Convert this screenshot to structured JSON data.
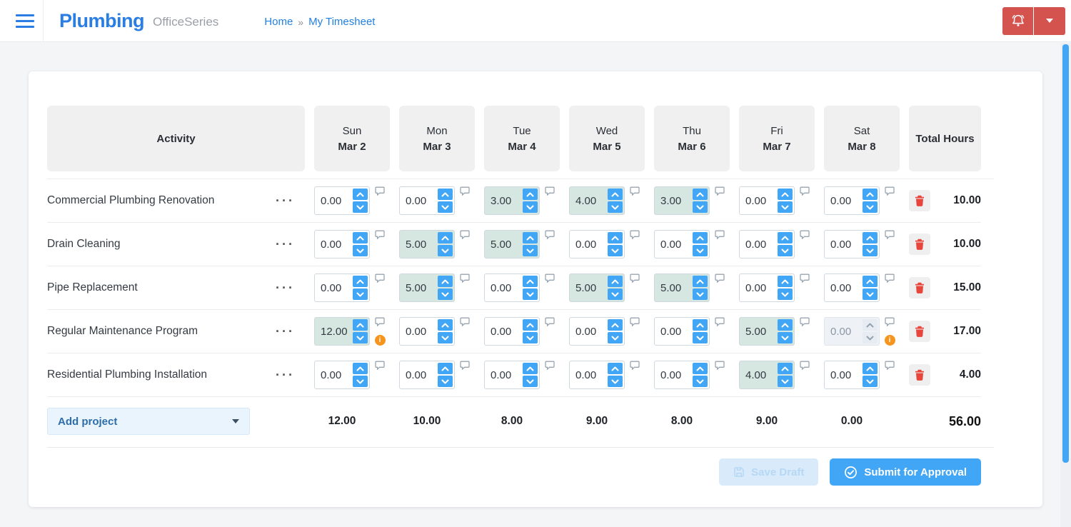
{
  "topbar": {
    "brand": "Plumbing",
    "suite": "OfficeSeries",
    "breadcrumb": {
      "home": "Home",
      "sep": "»",
      "current": "My Timesheet"
    }
  },
  "timesheet": {
    "columns": {
      "activity": "Activity",
      "days": [
        {
          "day": "Sun",
          "date": "Mar 2"
        },
        {
          "day": "Mon",
          "date": "Mar 3"
        },
        {
          "day": "Tue",
          "date": "Mar 4"
        },
        {
          "day": "Wed",
          "date": "Mar 5"
        },
        {
          "day": "Thu",
          "date": "Mar 6"
        },
        {
          "day": "Fri",
          "date": "Mar 7"
        },
        {
          "day": "Sat",
          "date": "Mar 8"
        }
      ],
      "total": "Total Hours"
    },
    "rows": [
      {
        "activity": "Commercial Plumbing Renovation",
        "cells": [
          {
            "value": "0.00",
            "state": "normal",
            "info": false
          },
          {
            "value": "0.00",
            "state": "normal",
            "info": false
          },
          {
            "value": "3.00",
            "state": "filled",
            "info": false
          },
          {
            "value": "4.00",
            "state": "filled",
            "info": false
          },
          {
            "value": "3.00",
            "state": "filled",
            "info": false
          },
          {
            "value": "0.00",
            "state": "normal",
            "info": false
          },
          {
            "value": "0.00",
            "state": "normal",
            "info": false
          }
        ],
        "total": "10.00"
      },
      {
        "activity": "Drain Cleaning",
        "cells": [
          {
            "value": "0.00",
            "state": "normal",
            "info": false
          },
          {
            "value": "5.00",
            "state": "filled",
            "info": false
          },
          {
            "value": "5.00",
            "state": "filled",
            "info": false
          },
          {
            "value": "0.00",
            "state": "normal",
            "info": false
          },
          {
            "value": "0.00",
            "state": "normal",
            "info": false
          },
          {
            "value": "0.00",
            "state": "normal",
            "info": false
          },
          {
            "value": "0.00",
            "state": "normal",
            "info": false
          }
        ],
        "total": "10.00"
      },
      {
        "activity": "Pipe Replacement",
        "cells": [
          {
            "value": "0.00",
            "state": "normal",
            "info": false
          },
          {
            "value": "5.00",
            "state": "filled",
            "info": false
          },
          {
            "value": "0.00",
            "state": "normal",
            "info": false
          },
          {
            "value": "5.00",
            "state": "filled",
            "info": false
          },
          {
            "value": "5.00",
            "state": "filled",
            "info": false
          },
          {
            "value": "0.00",
            "state": "normal",
            "info": false
          },
          {
            "value": "0.00",
            "state": "normal",
            "info": false
          }
        ],
        "total": "15.00"
      },
      {
        "activity": "Regular Maintenance Program",
        "cells": [
          {
            "value": "12.00",
            "state": "filled",
            "info": true
          },
          {
            "value": "0.00",
            "state": "normal",
            "info": false
          },
          {
            "value": "0.00",
            "state": "normal",
            "info": false
          },
          {
            "value": "0.00",
            "state": "normal",
            "info": false
          },
          {
            "value": "0.00",
            "state": "normal",
            "info": false
          },
          {
            "value": "5.00",
            "state": "filled",
            "info": false
          },
          {
            "value": "0.00",
            "state": "disabled",
            "info": true
          }
        ],
        "total": "17.00"
      },
      {
        "activity": "Residential Plumbing Installation",
        "cells": [
          {
            "value": "0.00",
            "state": "normal",
            "info": false
          },
          {
            "value": "0.00",
            "state": "normal",
            "info": false
          },
          {
            "value": "0.00",
            "state": "normal",
            "info": false
          },
          {
            "value": "0.00",
            "state": "normal",
            "info": false
          },
          {
            "value": "0.00",
            "state": "normal",
            "info": false
          },
          {
            "value": "4.00",
            "state": "filled",
            "info": false
          },
          {
            "value": "0.00",
            "state": "normal",
            "info": false
          }
        ],
        "total": "4.00"
      }
    ],
    "footer": {
      "add_project_label": "Add project",
      "day_totals": [
        "12.00",
        "10.00",
        "8.00",
        "9.00",
        "8.00",
        "9.00",
        "0.00"
      ],
      "grand_total": "56.00"
    },
    "actions": {
      "save_draft": "Save Draft",
      "submit": "Submit for Approval"
    }
  },
  "icons": {
    "menu": "hamburger",
    "notifications": "bell",
    "account": "caret-down",
    "row_menu": "···",
    "comment": "speech-bubble",
    "info": "i",
    "delete": "trash",
    "save": "floppy-disk",
    "submit": "check-circle",
    "spinner_up": "chevron-up",
    "spinner_down": "chevron-down"
  },
  "colors": {
    "brand_blue": "#2a7de2",
    "link_blue": "#2180e2",
    "header_red": "#d4534f",
    "spinner_blue": "#41a6f5",
    "filled_cell_teal": "#d6e7e1",
    "disabled_cell": "#eef1f6",
    "info_orange": "#f7941d",
    "delete_red": "#e8463c",
    "save_disabled_bg": "#d9eafa",
    "submit_blue": "#41a6f5",
    "scrollbar_blue": "#41a6f5"
  }
}
